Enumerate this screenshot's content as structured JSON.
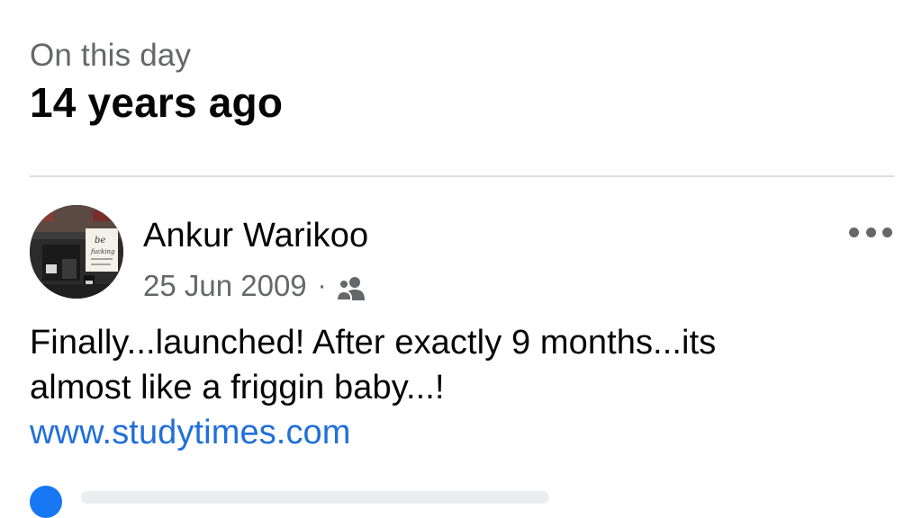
{
  "memory": {
    "subtitle": "On this day",
    "title": "14 years ago"
  },
  "post": {
    "author": "Ankur Warikoo",
    "date": "25 Jun 2009",
    "separator": "·",
    "audience_icon": "friends-icon",
    "text_line1": "Finally...launched! After exactly 9 months...its",
    "text_line2": "almost like a friggin baby...!",
    "link": "www.studytimes.com"
  },
  "colors": {
    "secondary_text": "#65676b",
    "link": "#216fdb",
    "divider": "#dadde1"
  }
}
